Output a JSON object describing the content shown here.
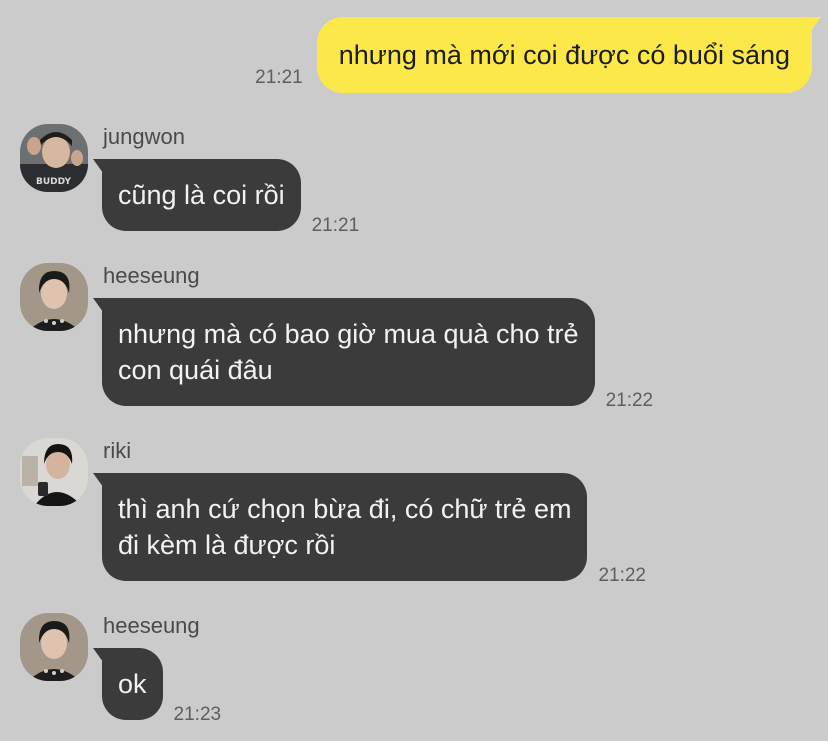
{
  "outgoing": {
    "text": "nhưng mà mới coi được có buổi sáng",
    "time": "21:21"
  },
  "messages": [
    {
      "sender": "jungwon",
      "avatar": "jungwon-avatar",
      "lines": [
        "cũng là coi rồi"
      ],
      "time": "21:21"
    },
    {
      "sender": "heeseung",
      "avatar": "heeseung-avatar",
      "lines": [
        "nhưng mà có bao giờ mua quà cho trẻ",
        "con quái đâu"
      ],
      "time": "21:22"
    },
    {
      "sender": "riki",
      "avatar": "riki-avatar",
      "lines": [
        "thì anh cứ chọn bừa đi, có chữ trẻ em",
        "đi kèm là được rồi"
      ],
      "time": "21:22"
    },
    {
      "sender": "heeseung",
      "avatar": "heeseung-avatar",
      "lines": [
        "ok"
      ],
      "time": "21:23"
    }
  ],
  "colors": {
    "background": "#cbcbcb",
    "outgoing_bubble": "#fde84a",
    "incoming_bubble": "#3b3b3c"
  }
}
